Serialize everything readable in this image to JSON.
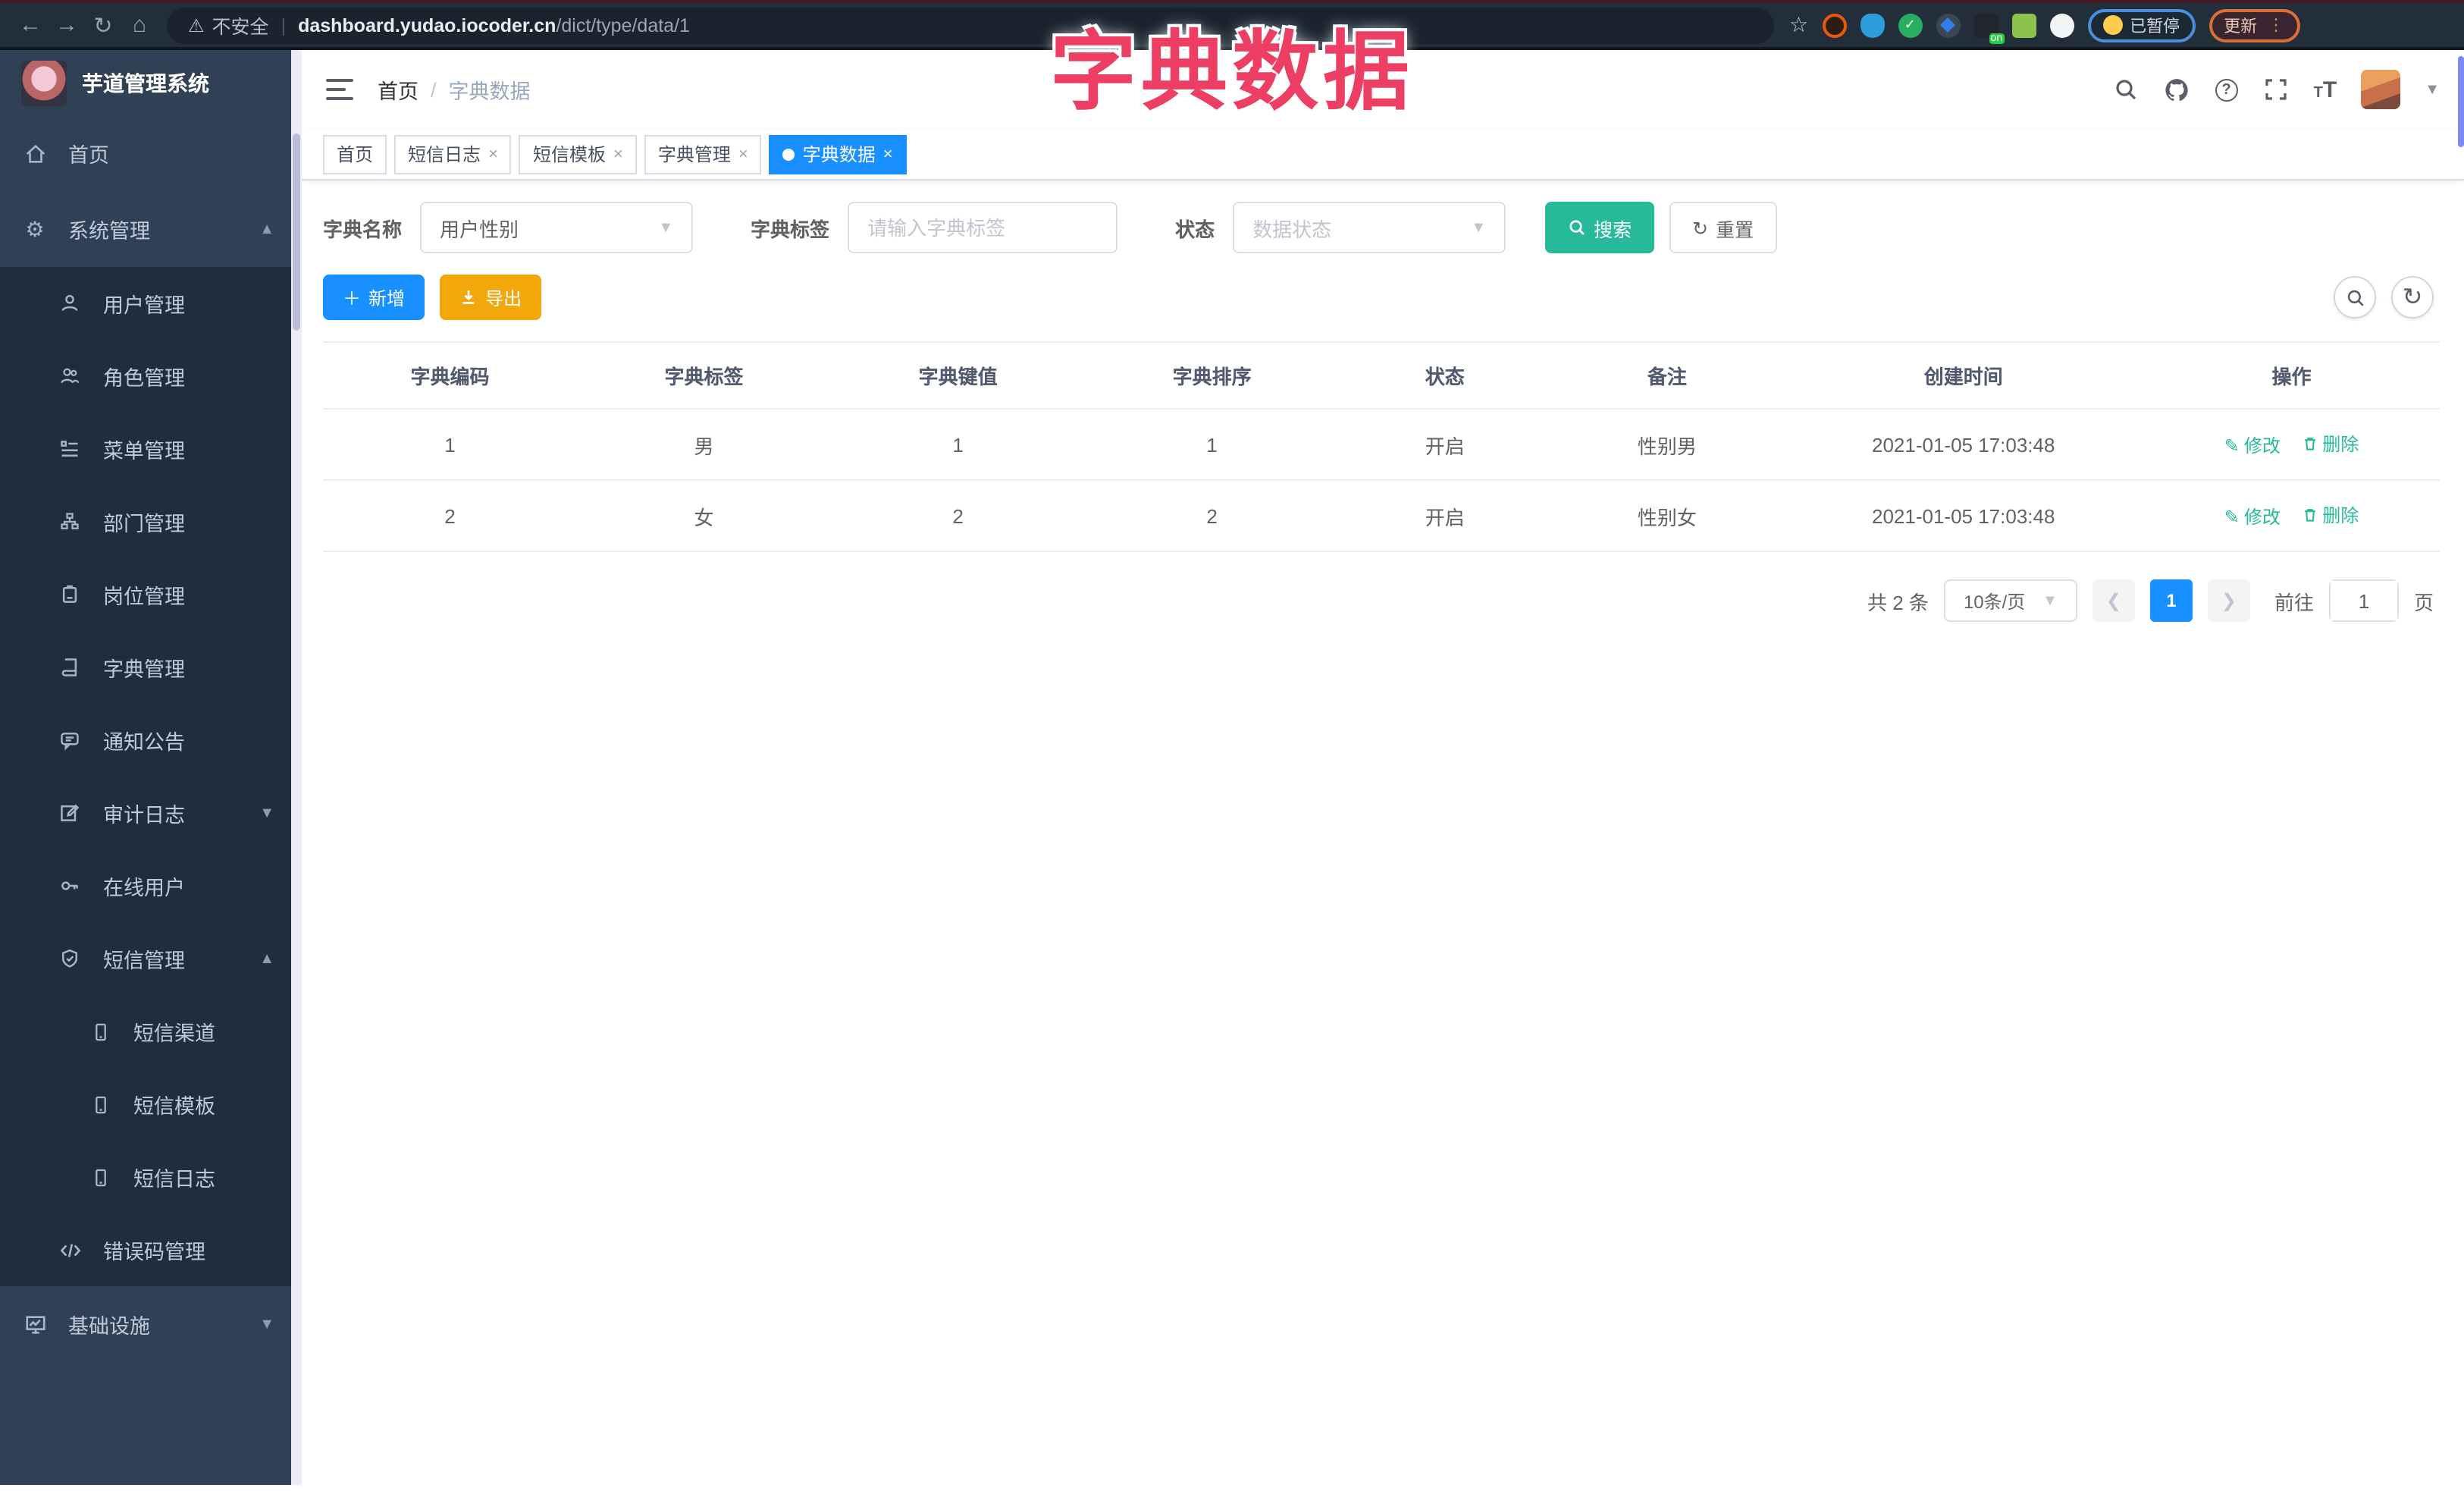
{
  "overlay_title": "字典数据",
  "browser": {
    "security_label": "不安全",
    "url_host": "dashboard.yudao.iocoder.cn",
    "url_path": "/dict/type/data/1",
    "paused_badge": "已暂停",
    "update_button": "更新",
    "on_badge": "on"
  },
  "sidebar": {
    "app_title": "芋道管理系统",
    "items": {
      "home": "首页",
      "system": "系统管理",
      "user": "用户管理",
      "role": "角色管理",
      "menu": "菜单管理",
      "dept": "部门管理",
      "post": "岗位管理",
      "dict": "字典管理",
      "notice": "通知公告",
      "audit": "审计日志",
      "online": "在线用户",
      "sms": "短信管理",
      "sms_channel": "短信渠道",
      "sms_template": "短信模板",
      "sms_log": "短信日志",
      "errcode": "错误码管理",
      "infra": "基础设施"
    }
  },
  "header": {
    "breadcrumb_home": "首页",
    "breadcrumb_current": "字典数据"
  },
  "tags": {
    "t0": "首页",
    "t1": "短信日志",
    "t2": "短信模板",
    "t3": "字典管理",
    "t4": "字典数据"
  },
  "filters": {
    "name_label": "字典名称",
    "name_value": "用户性别",
    "tag_label": "字典标签",
    "tag_placeholder": "请输入字典标签",
    "status_label": "状态",
    "status_placeholder": "数据状态",
    "search_label": "搜索",
    "reset_label": "重置"
  },
  "toolbar": {
    "add_label": "新增",
    "export_label": "导出"
  },
  "table": {
    "headers": [
      "字典编码",
      "字典标签",
      "字典键值",
      "字典排序",
      "状态",
      "备注",
      "创建时间",
      "操作"
    ],
    "rows": [
      [
        "1",
        "男",
        "1",
        "1",
        "开启",
        "性别男",
        "2021-01-05 17:03:48"
      ],
      [
        "2",
        "女",
        "2",
        "2",
        "开启",
        "性别女",
        "2021-01-05 17:03:48"
      ]
    ],
    "edit_label": "修改",
    "delete_label": "删除"
  },
  "pagination": {
    "total_text": "共 2 条",
    "page_size": "10条/页",
    "current_page": "1",
    "goto_label": "前往",
    "goto_value": "1",
    "unit_label": "页"
  },
  "colors": {
    "accent_teal": "#26b99a",
    "primary_blue": "#1890ff",
    "export_orange": "#f2a70a",
    "annotation_pink": "#ed3f63",
    "sidebar_bg": "#304156",
    "submenu_bg": "#1f2d3d"
  }
}
